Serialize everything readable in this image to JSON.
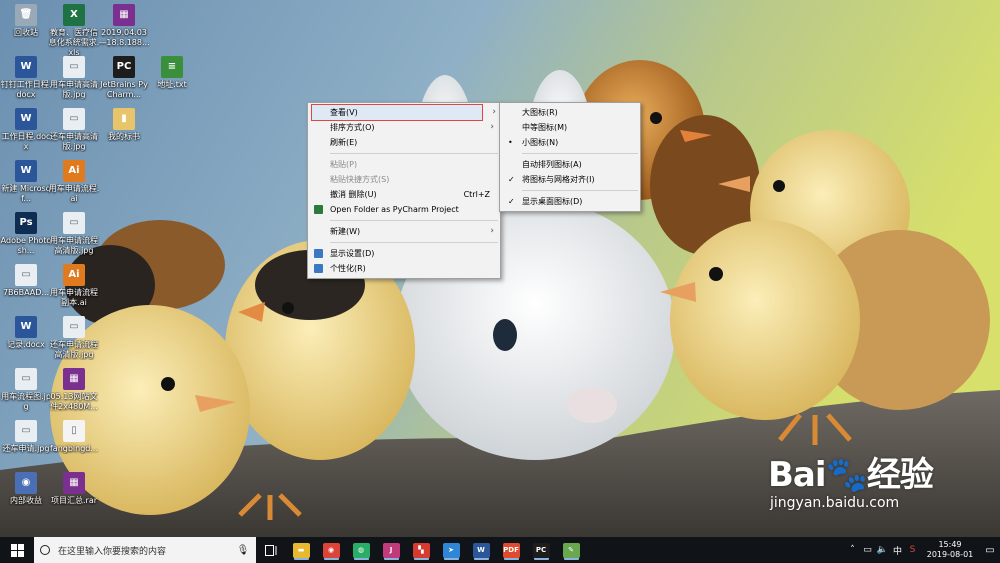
{
  "desktop": {
    "icons": [
      {
        "label": "回收站",
        "glyph": "🗑",
        "color": "#9aa9b8"
      },
      {
        "label": "教育、医疗信息化系统需求.xls",
        "glyph": "X",
        "color": "#1f7244"
      },
      {
        "label": "2019.04.03—18.8.188...",
        "glyph": "▦",
        "color": "#7b2f8f"
      },
      {
        "label": "钉钉工作日程.docx",
        "glyph": "W",
        "color": "#2b579a"
      },
      {
        "label": "用车申请高清版.jpg",
        "glyph": "▭",
        "color": "#e9eef2"
      },
      {
        "label": "JetBrains PyCharm...",
        "glyph": "PC",
        "color": "#1d1d1d"
      },
      {
        "label": "地址.txt",
        "glyph": "≡",
        "color": "#3a8f3a"
      },
      {
        "label": "工作日程.docx",
        "glyph": "W",
        "color": "#2b579a"
      },
      {
        "label": "还车申请高清版.jpg",
        "glyph": "▭",
        "color": "#e9eef2"
      },
      {
        "label": "我的标书",
        "glyph": "▮",
        "color": "#e8c46a"
      },
      {
        "label": "新建 Microsof...",
        "glyph": "W",
        "color": "#2b579a"
      },
      {
        "label": "用车申请流程.ai",
        "glyph": "Ai",
        "color": "#e07a1f"
      },
      {
        "label": "Adobe Photosh...",
        "glyph": "Ps",
        "color": "#0f2d52"
      },
      {
        "label": "用车申请流程高清版.jpg",
        "glyph": "▭",
        "color": "#e9eef2"
      },
      {
        "label": "7B6BAAD...",
        "glyph": "▭",
        "color": "#e9eef2"
      },
      {
        "label": "用车申请流程副本.ai",
        "glyph": "Ai",
        "color": "#e07a1f"
      },
      {
        "label": "记录.docx",
        "glyph": "W",
        "color": "#2b579a"
      },
      {
        "label": "还车申请流程高清版.jpg",
        "glyph": "▭",
        "color": "#e9eef2"
      },
      {
        "label": "用车流程图.jpg",
        "glyph": "▭",
        "color": "#e9eef2"
      },
      {
        "label": "05.13网站文件2x480M...",
        "glyph": "▦",
        "color": "#7b2f8f"
      },
      {
        "label": "还车申请.jpg",
        "glyph": "▭",
        "color": "#e9eef2"
      },
      {
        "label": "fangbingd...",
        "glyph": "▯",
        "color": "#f4f4f4"
      },
      {
        "label": "内部收益",
        "glyph": "◉",
        "color": "#4a6fb5"
      },
      {
        "label": "项目汇总.rar",
        "glyph": "▦",
        "color": "#7b2f8f"
      }
    ]
  },
  "context_menu": {
    "items": [
      {
        "label": "查看(V)",
        "submenu": true,
        "highlighted": true
      },
      {
        "label": "排序方式(O)",
        "submenu": true
      },
      {
        "label": "刷新(E)"
      },
      {
        "sep": true
      },
      {
        "label": "粘贴(P)",
        "disabled": true
      },
      {
        "label": "粘贴快捷方式(S)",
        "disabled": true
      },
      {
        "label": "撤消 删除(U)",
        "shortcut": "Ctrl+Z"
      },
      {
        "label": "Open Folder as PyCharm Project",
        "icon": "pycharm-icon",
        "iconColor": "#2a7a3a"
      },
      {
        "sep": true
      },
      {
        "label": "新建(W)",
        "submenu": true
      },
      {
        "sep": true
      },
      {
        "label": "显示设置(D)",
        "icon": "display-icon",
        "iconColor": "#3b78c4"
      },
      {
        "label": "个性化(R)",
        "icon": "personalize-icon",
        "iconColor": "#3b78c4"
      }
    ]
  },
  "view_submenu": {
    "items": [
      {
        "label": "大图标(R)"
      },
      {
        "label": "中等图标(M)"
      },
      {
        "label": "小图标(N)",
        "mark": "•"
      },
      {
        "sep": true
      },
      {
        "label": "自动排列图标(A)"
      },
      {
        "label": "将图标与网格对齐(I)",
        "mark": "✓"
      },
      {
        "sep": true
      },
      {
        "label": "显示桌面图标(D)",
        "mark": "✓"
      }
    ]
  },
  "taskbar": {
    "search_placeholder": "在这里输入你要搜索的内容",
    "apps": [
      {
        "name": "file-explorer-icon",
        "glyph": "▬",
        "color": "#e8b830"
      },
      {
        "name": "chrome-icon",
        "glyph": "◉",
        "color": "#db4437"
      },
      {
        "name": "wechat-icon",
        "glyph": "◍",
        "color": "#2aae67"
      },
      {
        "name": "jetbrains-icon",
        "glyph": "J",
        "color": "#c13a7a"
      },
      {
        "name": "kingsoft-icon",
        "glyph": "▚",
        "color": "#d73b2f"
      },
      {
        "name": "feishu-icon",
        "glyph": "➤",
        "color": "#2f86d6"
      },
      {
        "name": "word-icon",
        "glyph": "W",
        "color": "#2b579a"
      },
      {
        "name": "pdf-icon",
        "glyph": "PDF",
        "color": "#e04b2e"
      },
      {
        "name": "pycharm-icon",
        "glyph": "PC",
        "color": "#1d1d1d"
      },
      {
        "name": "notepad-icon",
        "glyph": "✎",
        "color": "#6aa84f"
      }
    ],
    "clock_time": "15:49",
    "clock_date": "2019-08-01"
  },
  "watermark": {
    "brand": "Bai🐾经验",
    "url": "jingyan.baidu.com"
  }
}
